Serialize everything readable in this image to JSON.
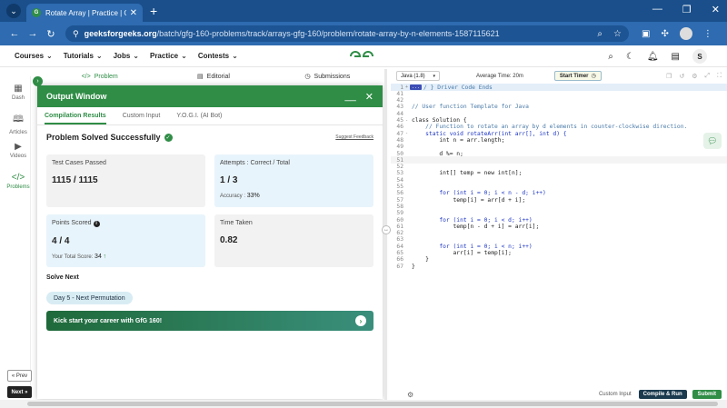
{
  "browser": {
    "tab_title": "Rotate Array | Practice | GeeksforGeeks",
    "tab_close": "✕",
    "new_tab": "+",
    "url_host": "geeksforgeeks.org",
    "url_path": "/batch/gfg-160-problems/track/arrays-gfg-160/problem/rotate-array-by-n-elements-1587115621",
    "win_controls": [
      "—",
      "❐",
      "✕"
    ]
  },
  "header": {
    "menu": [
      "Courses",
      "Tutorials",
      "Jobs",
      "Practice",
      "Contests"
    ],
    "logo": "GG",
    "user_initial": "S"
  },
  "rail": {
    "items": [
      "Dash",
      "Articles",
      "Videos",
      "Problems"
    ],
    "prev_label": "« Prev",
    "next_label": "Next »"
  },
  "problem_tabs": [
    "Problem",
    "Editorial",
    "Submissions"
  ],
  "output": {
    "title": "Output Window",
    "tabs": [
      "Compilation Results",
      "Custom Input",
      "Y.O.G.I. (AI Bot)"
    ],
    "status": "Problem Solved Successfully",
    "feedback": "Suggest Feedback",
    "test_cases_label": "Test Cases Passed",
    "test_cases_value": "1115 / 1115",
    "attempts_label": "Attempts : Correct / Total",
    "attempts_value": "1 / 3",
    "accuracy_label": "Accuracy :",
    "accuracy_value": "33%",
    "points_label": "Points Scored",
    "points_value": "4 / 4",
    "total_score_label": "Your Total Score:",
    "total_score_value": "34",
    "time_label": "Time Taken",
    "time_value": "0.82",
    "solve_next_label": "Solve Next",
    "next_problem": "Day 5 - Next Permutation",
    "banner": "Kick start your career with GfG 160!"
  },
  "editor": {
    "language": "Java (1.8)",
    "avg_time": "Average Time: 20m",
    "timer_label": "Start Timer",
    "custom_input": "Custom Input",
    "compile_run": "Compile & Run",
    "submit": "Submit",
    "lines": [
      {
        "n": "1",
        "fold": "+",
        "text": "/ } Driver Code Ends",
        "tag": "...",
        "cls": "cm",
        "hl": true
      },
      {
        "n": "41",
        "fold": "",
        "text": "",
        "cls": ""
      },
      {
        "n": "42",
        "fold": "",
        "text": "",
        "cls": ""
      },
      {
        "n": "43",
        "fold": "",
        "text": "// User function Template for Java",
        "cls": "cm"
      },
      {
        "n": "44",
        "fold": "",
        "text": "",
        "cls": ""
      },
      {
        "n": "45",
        "fold": "-",
        "text": "class Solution {",
        "cls": ""
      },
      {
        "n": "46",
        "fold": "",
        "text": "    // Function to rotate an array by d elements in counter-clockwise direction.",
        "cls": "cm"
      },
      {
        "n": "47",
        "fold": "-",
        "text": "    static void rotateArr(int arr[], int d) {",
        "cls": "kw"
      },
      {
        "n": "48",
        "fold": "",
        "text": "        int n = arr.length;",
        "cls": ""
      },
      {
        "n": "49",
        "fold": "",
        "text": "",
        "cls": ""
      },
      {
        "n": "50",
        "fold": "",
        "text": "        d %= n;",
        "cls": ""
      },
      {
        "n": "51",
        "fold": "",
        "text": "",
        "cls": "",
        "cur": true
      },
      {
        "n": "52",
        "fold": "",
        "text": "",
        "cls": ""
      },
      {
        "n": "53",
        "fold": "",
        "text": "        int[] temp = new int[n];",
        "cls": ""
      },
      {
        "n": "54",
        "fold": "",
        "text": "",
        "cls": ""
      },
      {
        "n": "55",
        "fold": "",
        "text": "",
        "cls": ""
      },
      {
        "n": "56",
        "fold": "",
        "text": "        for (int i = 0; i < n - d; i++)",
        "cls": "kw"
      },
      {
        "n": "57",
        "fold": "",
        "text": "            temp[i] = arr[d + i];",
        "cls": ""
      },
      {
        "n": "58",
        "fold": "",
        "text": "",
        "cls": ""
      },
      {
        "n": "59",
        "fold": "",
        "text": "",
        "cls": ""
      },
      {
        "n": "60",
        "fold": "",
        "text": "        for (int i = 0; i < d; i++)",
        "cls": "kw"
      },
      {
        "n": "61",
        "fold": "",
        "text": "            temp[n - d + i] = arr[i];",
        "cls": ""
      },
      {
        "n": "62",
        "fold": "",
        "text": "",
        "cls": ""
      },
      {
        "n": "63",
        "fold": "",
        "text": "",
        "cls": ""
      },
      {
        "n": "64",
        "fold": "",
        "text": "        for (int i = 0; i < n; i++)",
        "cls": "kw"
      },
      {
        "n": "65",
        "fold": "",
        "text": "            arr[i] = temp[i];",
        "cls": ""
      },
      {
        "n": "66",
        "fold": "",
        "text": "    }",
        "cls": ""
      },
      {
        "n": "67",
        "fold": "",
        "text": "}",
        "cls": ""
      }
    ]
  },
  "colors": {
    "brand_green": "#2f8d46",
    "chrome_blue": "#2e6bb0"
  }
}
